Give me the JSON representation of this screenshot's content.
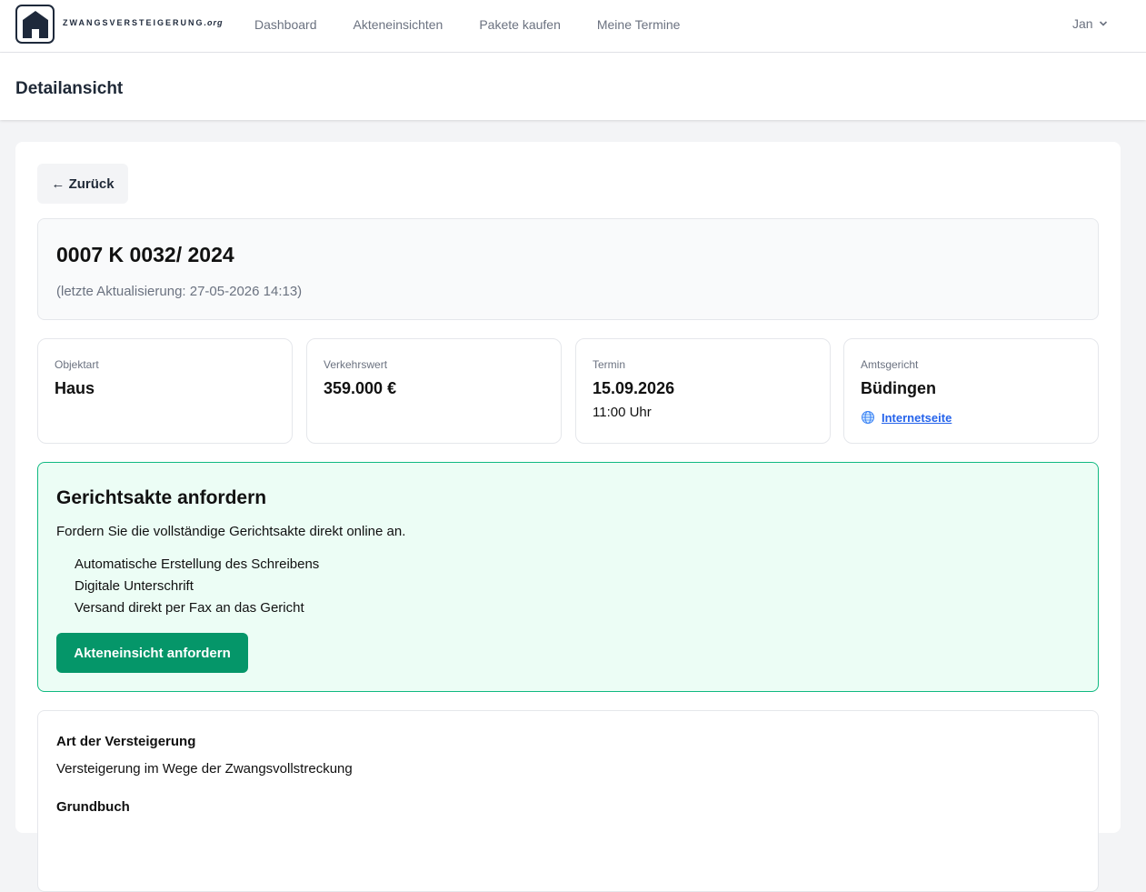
{
  "nav": {
    "brand": "ZWANGSVERSTEIGERUNG",
    "brand_tld": ".org",
    "links": [
      "Dashboard",
      "Akteneinsichten",
      "Pakete kaufen",
      "Meine Termine"
    ],
    "user": "Jan",
    "icons": [
      "house-icon",
      "chevron-down-icon"
    ]
  },
  "header": {
    "title": "Detailansicht"
  },
  "back_label": "← Zurück",
  "case": {
    "number": "0007 K 0032/ 2024",
    "updated": "(letzte Aktualisierung: 27-05-2026 14:13)"
  },
  "info": {
    "objektart": {
      "label": "Objektart",
      "value": "Haus"
    },
    "verkehrswert": {
      "label": "Verkehrswert",
      "value": "359.000 €"
    },
    "termin": {
      "label": "Termin",
      "date": "15.09.2026",
      "time": "11:00 Uhr"
    },
    "amtsgericht": {
      "label": "Amtsgericht",
      "value": "Büdingen",
      "link": "Internetseite",
      "icon": "globe-icon"
    }
  },
  "request": {
    "title": "Gerichtsakte anfordern",
    "description": "Fordern Sie die vollständige Gerichtsakte direkt online an.",
    "features": [
      "Automatische Erstellung des Schreibens",
      "Digitale Unterschrift",
      "Versand direkt per Fax an das Gericht"
    ],
    "button": "Akteneinsicht anfordern"
  },
  "details": {
    "art_heading": "Art der Versteigerung",
    "art_value": "Versteigerung im Wege der Zwangsvollstreckung",
    "grundbuch_heading": "Grundbuch"
  },
  "colors": {
    "accent_green": "#059669",
    "request_bg": "#ecfdf5",
    "link_blue": "#2563eb",
    "brand_dark": "#1e293b"
  }
}
